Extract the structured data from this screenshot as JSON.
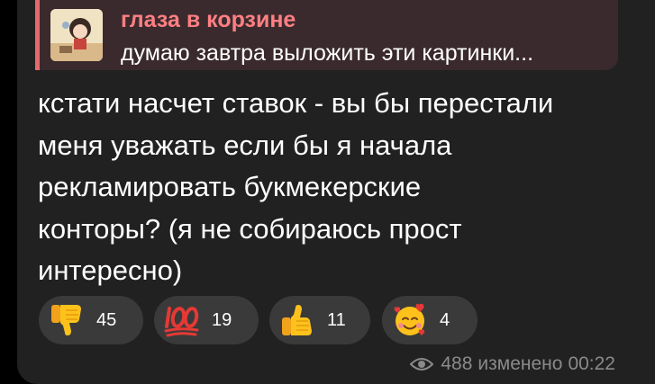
{
  "reply": {
    "author": "глаза в корзине",
    "text": "думаю завтра выложить эти картинки..."
  },
  "message": {
    "lines": [
      "кстати насчет ставок - вы бы перестали",
      "меня уважать если бы я начала",
      "рекламировать букмекерские",
      "конторы? (я не собираюсь прост",
      "интересно)"
    ]
  },
  "reactions": [
    {
      "emoji": "thumbs-down",
      "count": "45"
    },
    {
      "emoji": "hundred-points",
      "count": "19"
    },
    {
      "emoji": "thumbs-up",
      "count": "11"
    },
    {
      "emoji": "smiling-face-with-hearts",
      "count": "4"
    }
  ],
  "meta": {
    "views": "488",
    "edited": "изменено",
    "time": "00:22"
  },
  "colors": {
    "bubble": "#212121",
    "reply_accent": "#e46a6f",
    "reply_author": "#ff7f83",
    "reaction_bg": "#3a3a3a",
    "meta_text": "#8a8a8a"
  }
}
